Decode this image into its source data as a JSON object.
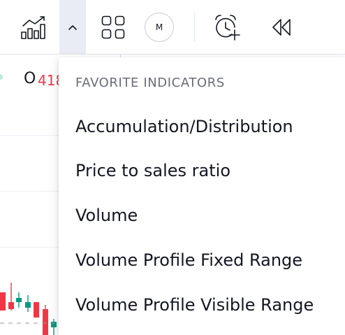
{
  "toolbar": {
    "indicators_icon": "indicators-chart-icon",
    "fav_toggle_icon": "chevron-up-icon",
    "templates_icon": "grid-icon",
    "replay_mode_label": "M",
    "alert_icon": "alarm-clock-plus-icon",
    "rewind_icon": "rewind-icon"
  },
  "chart": {
    "ohlc_open_label": "O",
    "ohlc_open_value": "418"
  },
  "favorites_menu": {
    "header": "FAVORITE INDICATORS",
    "items": [
      {
        "label": "Accumulation/Distribution"
      },
      {
        "label": "Price to sales ratio"
      },
      {
        "label": "Volume"
      },
      {
        "label": "Volume Profile Fixed Range"
      },
      {
        "label": "Volume Profile Visible Range"
      }
    ]
  },
  "colors": {
    "accent_active_bg": "#e9ecf5",
    "text_primary": "#131722",
    "text_secondary": "#6a6d78",
    "candle_down": "#f23645",
    "candle_up": "#089981"
  }
}
